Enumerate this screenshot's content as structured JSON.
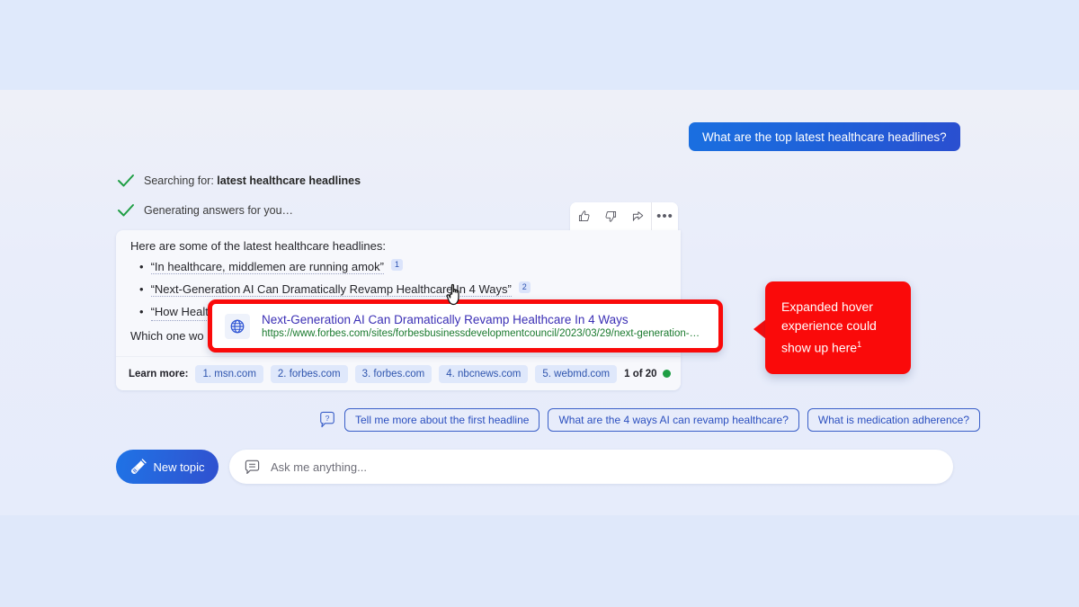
{
  "user_message": {
    "text": "What are the top latest healthcare headlines?"
  },
  "status": {
    "search_prefix": "Searching for: ",
    "search_query": "latest healthcare headlines",
    "generating": "Generating answers for you…"
  },
  "toolbar": {
    "thumbs_up": "thumbs-up",
    "thumbs_down": "thumbs-down",
    "share": "share",
    "more": "•••"
  },
  "answer": {
    "intro": "Here are some of the latest healthcare headlines:",
    "bullets": [
      {
        "text": "“In healthcare, middlemen are running amok”",
        "cite": "1"
      },
      {
        "text": "“Next-Generation AI Can Dramatically Revamp Healthcare In 4 Ways”",
        "cite": "2"
      },
      {
        "text": "“How Healt",
        "cite": ""
      }
    ],
    "outro": "Which one wo"
  },
  "learn_more": {
    "label": "Learn more:",
    "sources": [
      "1. msn.com",
      "2. forbes.com",
      "3. forbes.com",
      "4. nbcnews.com",
      "5. webmd.com"
    ],
    "counter": "1 of 20"
  },
  "tooltip": {
    "icon": "globe-icon",
    "title": "Next-Generation AI Can Dramatically Revamp Healthcare In 4 Ways",
    "url": "https://www.forbes.com/sites/forbesbusinessdevelopmentcouncil/2023/03/29/next-generation-…"
  },
  "callout": {
    "line1": "Expanded hover",
    "line2": "experience could",
    "line3": "show up here",
    "footnote": "1"
  },
  "suggestions": {
    "help_icon": "question-mark-icon",
    "chips": [
      "Tell me more about the first headline",
      "What are the 4 ways AI can revamp healthcare?",
      "What is medication adherence?"
    ]
  },
  "composer": {
    "new_topic_label": "New topic",
    "placeholder": "Ask me anything...",
    "value": ""
  },
  "colors": {
    "accent_blue": "#2a5fd8",
    "callout_red": "#fa0a0a",
    "link_purple": "#3b2fb5",
    "url_green": "#1a7a2e",
    "check_green": "#1e9e44",
    "chip_blue": "#dfe8fb"
  }
}
